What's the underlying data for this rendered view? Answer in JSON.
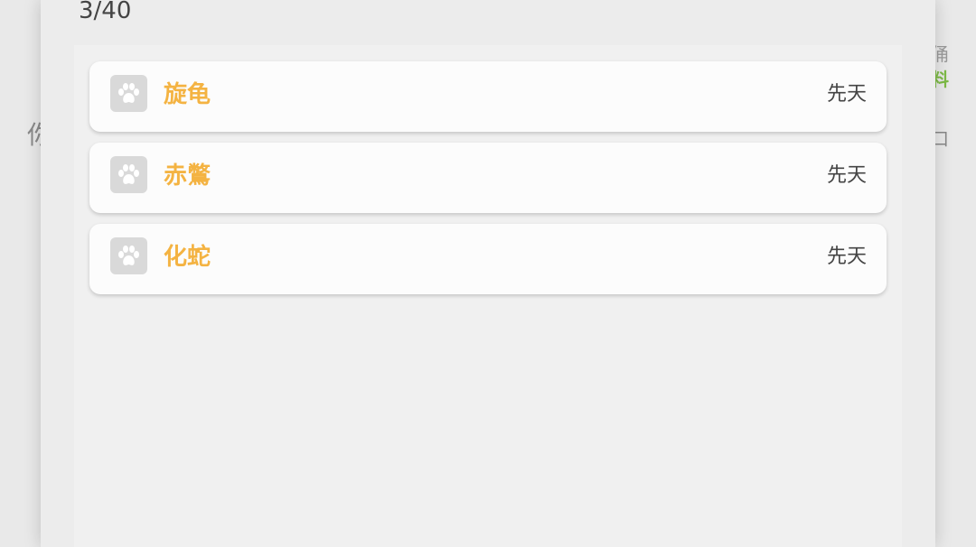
{
  "background": {
    "left_text": "你你",
    "right_top_text": "俑",
    "right_green_text": "料",
    "right_mid_text": "口"
  },
  "dialog": {
    "counter": "3/40",
    "items": [
      {
        "name": "旋龟",
        "type": "先天",
        "icon": "paw-icon"
      },
      {
        "name": "赤鷩",
        "type": "先天",
        "icon": "paw-icon"
      },
      {
        "name": "化蛇",
        "type": "先天",
        "icon": "paw-icon"
      }
    ]
  },
  "colors": {
    "name_accent": "#f4b342",
    "icon_bg": "#d9d9d9",
    "green_accent": "#7dbb45"
  }
}
